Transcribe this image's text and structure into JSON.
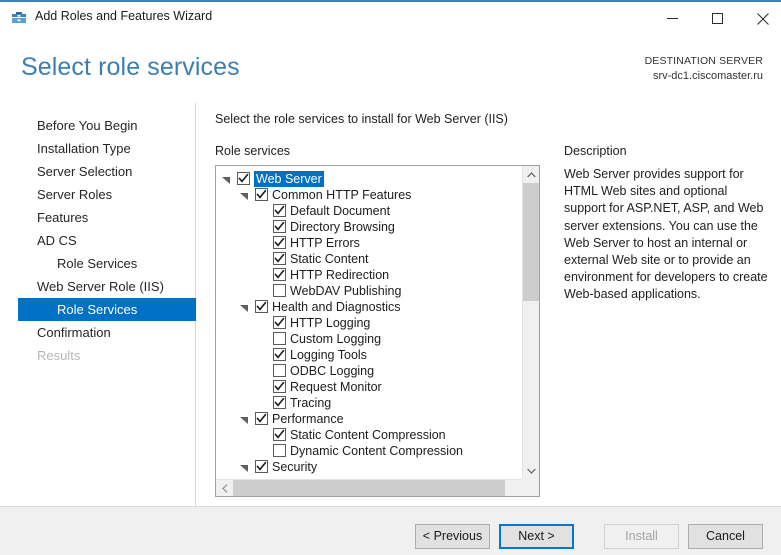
{
  "window": {
    "title": "Add Roles and Features Wizard",
    "icon": "server-wizard-icon",
    "minimize_label": "Minimize",
    "maximize_label": "Maximize",
    "close_label": "Close",
    "accent_color": "#3c81b8"
  },
  "header": {
    "page_title": "Select role services",
    "destination_label": "DESTINATION SERVER",
    "destination_server": "srv-dc1.ciscomaster.ru",
    "title_color": "#3b7fb3"
  },
  "sidebar": {
    "selection_color": "#0072c6",
    "items": [
      {
        "label": "Before You Begin",
        "level": 0,
        "state": "normal"
      },
      {
        "label": "Installation Type",
        "level": 0,
        "state": "normal"
      },
      {
        "label": "Server Selection",
        "level": 0,
        "state": "normal"
      },
      {
        "label": "Server Roles",
        "level": 0,
        "state": "normal"
      },
      {
        "label": "Features",
        "level": 0,
        "state": "normal"
      },
      {
        "label": "AD CS",
        "level": 0,
        "state": "normal"
      },
      {
        "label": "Role Services",
        "level": 1,
        "state": "normal"
      },
      {
        "label": "Web Server Role (IIS)",
        "level": 0,
        "state": "normal"
      },
      {
        "label": "Role Services",
        "level": 1,
        "state": "selected"
      },
      {
        "label": "Confirmation",
        "level": 0,
        "state": "normal"
      },
      {
        "label": "Results",
        "level": 0,
        "state": "disabled"
      }
    ]
  },
  "content": {
    "instruction": "Select the role services to install for Web Server (IIS)",
    "group_label": "Role services",
    "description_label": "Description",
    "description_text": "Web Server provides support for HTML Web sites and optional support for ASP.NET, ASP, and Web server extensions. You can use the Web Server to host an internal or external Web site or to provide an environment for developers to create Web-based applications.",
    "tree": [
      {
        "label": "Web Server",
        "level": 0,
        "checked": true,
        "expander": "expanded",
        "selected": true
      },
      {
        "label": "Common HTTP Features",
        "level": 1,
        "checked": true,
        "expander": "expanded",
        "selected": false
      },
      {
        "label": "Default Document",
        "level": 2,
        "checked": true,
        "expander": "none",
        "selected": false
      },
      {
        "label": "Directory Browsing",
        "level": 2,
        "checked": true,
        "expander": "none",
        "selected": false
      },
      {
        "label": "HTTP Errors",
        "level": 2,
        "checked": true,
        "expander": "none",
        "selected": false
      },
      {
        "label": "Static Content",
        "level": 2,
        "checked": true,
        "expander": "none",
        "selected": false
      },
      {
        "label": "HTTP Redirection",
        "level": 2,
        "checked": true,
        "expander": "none",
        "selected": false
      },
      {
        "label": "WebDAV Publishing",
        "level": 2,
        "checked": false,
        "expander": "none",
        "selected": false
      },
      {
        "label": "Health and Diagnostics",
        "level": 1,
        "checked": true,
        "expander": "expanded",
        "selected": false
      },
      {
        "label": "HTTP Logging",
        "level": 2,
        "checked": true,
        "expander": "none",
        "selected": false
      },
      {
        "label": "Custom Logging",
        "level": 2,
        "checked": false,
        "expander": "none",
        "selected": false
      },
      {
        "label": "Logging Tools",
        "level": 2,
        "checked": true,
        "expander": "none",
        "selected": false
      },
      {
        "label": "ODBC Logging",
        "level": 2,
        "checked": false,
        "expander": "none",
        "selected": false
      },
      {
        "label": "Request Monitor",
        "level": 2,
        "checked": true,
        "expander": "none",
        "selected": false
      },
      {
        "label": "Tracing",
        "level": 2,
        "checked": true,
        "expander": "none",
        "selected": false
      },
      {
        "label": "Performance",
        "level": 1,
        "checked": true,
        "expander": "expanded",
        "selected": false
      },
      {
        "label": "Static Content Compression",
        "level": 2,
        "checked": true,
        "expander": "none",
        "selected": false
      },
      {
        "label": "Dynamic Content Compression",
        "level": 2,
        "checked": false,
        "expander": "none",
        "selected": false
      },
      {
        "label": "Security",
        "level": 1,
        "checked": true,
        "expander": "expanded",
        "selected": false
      }
    ]
  },
  "footer": {
    "previous_label": "< Previous",
    "next_label": "Next >",
    "install_label": "Install",
    "cancel_label": "Cancel",
    "default_button_color": "#0078d7"
  }
}
